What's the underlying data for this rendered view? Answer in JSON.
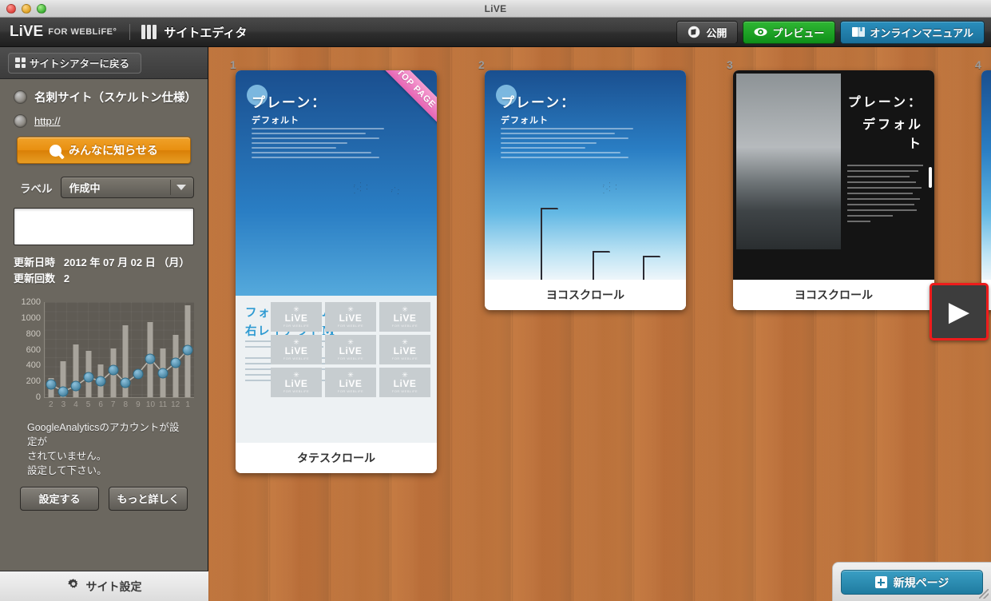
{
  "window": {
    "title": "LiVE"
  },
  "header": {
    "brand_live": "LiVE",
    "brand_for": "FOR WEBLiFE°",
    "editor_title": "サイトエディタ",
    "buttons": [
      {
        "label": "公開",
        "icon": "publish-icon",
        "style": "dark"
      },
      {
        "label": "プレビュー",
        "icon": "eye-icon",
        "style": "green"
      },
      {
        "label": "オンラインマニュアル",
        "icon": "book-icon",
        "style": "blue"
      }
    ]
  },
  "sidebar": {
    "back_button": {
      "label": "サイトシアターに戻る",
      "icon": "grid-icon"
    },
    "site_name": "名刺サイト（スケルトン仕様）",
    "site_url": "http://",
    "notify_button": {
      "label": "みんなに知らせる",
      "icon": "search-icon"
    },
    "label_field": {
      "label": "ラベル",
      "value": "作成中"
    },
    "memo_value": "",
    "meta": {
      "updated_label": "更新日時",
      "updated_value": "2012 年 07 月 02 日 （月）",
      "count_label": "更新回数",
      "count_value": "2"
    },
    "ga_notice_line1": "GoogleAnalyticsのアカウントが設定が",
    "ga_notice_line2": "されていません。",
    "ga_notice_line3": "設定して下さい。",
    "ga_buttons": [
      "設定する",
      "もっと詳しく"
    ],
    "footer_button": {
      "label": "サイト設定",
      "icon": "gear-icon"
    }
  },
  "chart_data": {
    "type": "bar",
    "title": "",
    "xlabel": "",
    "ylabel": "",
    "categories": [
      "2",
      "3",
      "4",
      "5",
      "6",
      "7",
      "8",
      "9",
      "10",
      "11",
      "12",
      "1"
    ],
    "yticks": [
      0,
      200,
      400,
      600,
      800,
      1000,
      1200
    ],
    "ylim": [
      0,
      1200
    ],
    "grid": true,
    "legend": "none",
    "series": [
      {
        "name": "bars",
        "type": "bar",
        "values": [
          245,
          450,
          670,
          585,
          415,
          620,
          910,
          0,
          950,
          620,
          785,
          1160
        ]
      },
      {
        "name": "line",
        "type": "line",
        "values": [
          160,
          75,
          140,
          255,
          200,
          340,
          180,
          295,
          485,
          305,
          430,
          600
        ]
      }
    ]
  },
  "canvas": {
    "page_numbers": [
      "1",
      "2",
      "3",
      "4"
    ],
    "ribbon_label": "TOP PAGE",
    "pages": [
      {
        "number": "1",
        "caption": "タテスクロール",
        "headline_1": "プレーン：",
        "headline_2": "デフォルト",
        "section_title_1": "フォトアルバム：",
        "section_title_2": "右レイアウトM",
        "tile_label": "LiVE",
        "tile_sub": "FOR WEBLiFE",
        "badge": "TOP PAGE"
      },
      {
        "number": "2",
        "caption": "ヨコスクロール",
        "headline_1": "プレーン：",
        "headline_2": "デフォルト"
      },
      {
        "number": "3",
        "caption": "ヨコスクロール",
        "headline_1": "プレーン：",
        "headline_2": "デフォルト"
      }
    ],
    "next_arrow": "▶",
    "new_page_button": {
      "label": "新規ページ",
      "icon": "plus-icon"
    }
  },
  "colors": {
    "accent_orange": "#e88f10",
    "accent_green": "#1f9c24",
    "accent_blue": "#2a8fbd",
    "wood": "#bb7138",
    "sidebar": "#6b675f",
    "highlight_red": "#ee1c1c",
    "ribbon_pink": "#e664b4",
    "chart_dot": "#46829f",
    "chart_bar": "#a8a49c"
  }
}
